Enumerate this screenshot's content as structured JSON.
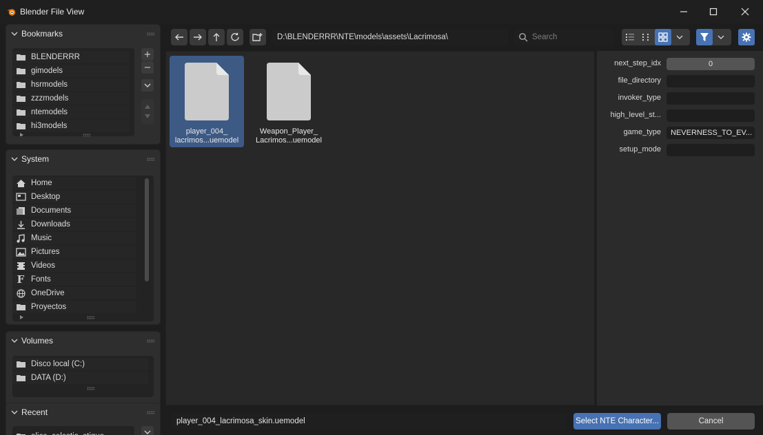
{
  "window": {
    "title": "Blender File View"
  },
  "sidebar": {
    "bookmarks": {
      "header": "Bookmarks",
      "items": [
        {
          "label": "BLENDERRR",
          "icon": "folder-icon"
        },
        {
          "label": "gimodels",
          "icon": "folder-icon"
        },
        {
          "label": "hsrmodels",
          "icon": "folder-icon"
        },
        {
          "label": "zzzmodels",
          "icon": "folder-icon"
        },
        {
          "label": "ntemodels",
          "icon": "folder-icon"
        },
        {
          "label": "hi3models",
          "icon": "folder-icon"
        }
      ],
      "add_label": "+",
      "remove_label": "−"
    },
    "system": {
      "header": "System",
      "items": [
        {
          "label": "Home",
          "icon": "home-icon"
        },
        {
          "label": "Desktop",
          "icon": "desktop-icon"
        },
        {
          "label": "Documents",
          "icon": "documents-icon"
        },
        {
          "label": "Downloads",
          "icon": "downloads-icon"
        },
        {
          "label": "Music",
          "icon": "music-icon"
        },
        {
          "label": "Pictures",
          "icon": "pictures-icon"
        },
        {
          "label": "Videos",
          "icon": "videos-icon"
        },
        {
          "label": "Fonts",
          "icon": "fonts-icon"
        },
        {
          "label": "OneDrive",
          "icon": "globe-icon"
        },
        {
          "label": "Proyectos",
          "icon": "folder-icon"
        }
      ]
    },
    "volumes": {
      "header": "Volumes",
      "items": [
        {
          "label": "Disco local (C:)",
          "icon": "disk-icon"
        },
        {
          "label": "DATA (D:)",
          "icon": "disk-icon"
        }
      ]
    },
    "recent": {
      "header": "Recent",
      "items": [
        {
          "label": "alice_celestia_stigue",
          "icon": "folder-icon"
        }
      ]
    }
  },
  "toolbar": {
    "path": "D:\\BLENDERRR\\NTE\\models\\assets\\Lacrimosa\\",
    "search_placeholder": "Search"
  },
  "files": [
    {
      "line1": "player_004_",
      "line2": "lacrimos...uemodel",
      "selected": true
    },
    {
      "line1": "Weapon_Player_",
      "line2": "Lacrimos...uemodel",
      "selected": false
    }
  ],
  "properties": [
    {
      "label": "next_step_idx",
      "value": "0",
      "kind": "number"
    },
    {
      "label": "file_directory",
      "value": "",
      "kind": "text"
    },
    {
      "label": "invoker_type",
      "value": "",
      "kind": "text"
    },
    {
      "label": "high_level_st...",
      "value": "",
      "kind": "text"
    },
    {
      "label": "game_type",
      "value": "NEVERNESS_TO_EV...",
      "kind": "text"
    },
    {
      "label": "setup_mode",
      "value": "",
      "kind": "text"
    }
  ],
  "footer": {
    "filename": "player_004_lacrimosa_skin.uemodel",
    "confirm_label": "Select NTE Character...",
    "cancel_label": "Cancel"
  },
  "colors": {
    "accent": "#4772b3",
    "selection": "#3d5a85",
    "background": "#1d1d1d"
  }
}
